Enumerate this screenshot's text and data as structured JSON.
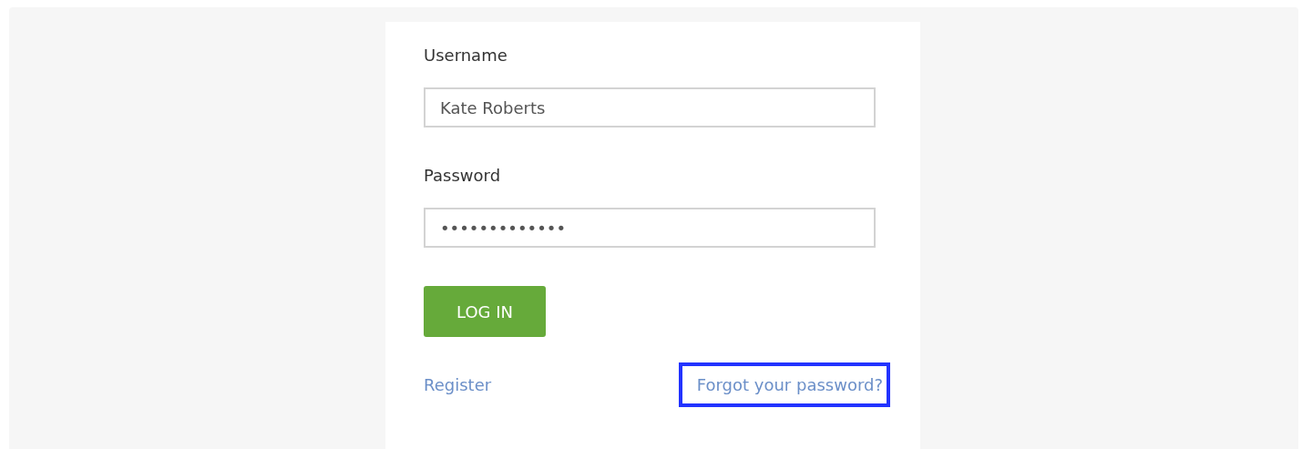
{
  "form": {
    "fields": [
      {
        "label": "Username",
        "value": "Kate Roberts"
      },
      {
        "label": "Password",
        "value": "•••••••••••••"
      }
    ],
    "submit": "LOG IN",
    "links": [
      {
        "text": "Register",
        "highlighted": false
      },
      {
        "text": "Forgot your password?",
        "highlighted": true
      }
    ]
  }
}
